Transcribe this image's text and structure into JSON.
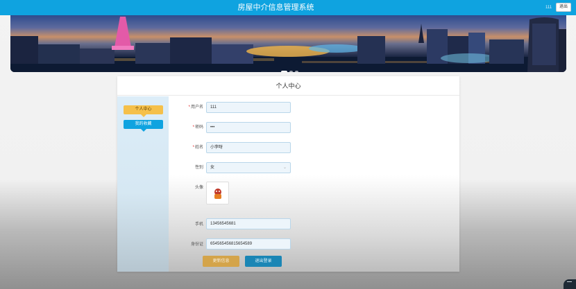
{
  "app": {
    "title": "房屋中介信息管理系统",
    "user": "111",
    "logout_label": "退出"
  },
  "banner": {
    "slides": 3,
    "active_slide": 1
  },
  "page": {
    "title": "个人中心"
  },
  "sidebar": {
    "items": [
      {
        "label": "个人中心",
        "active": true
      },
      {
        "label": "我的收藏",
        "active": false
      }
    ]
  },
  "form": {
    "username": {
      "label": "用户名",
      "required": true,
      "value": "111"
    },
    "password": {
      "label": "密码",
      "required": true,
      "value": "•••"
    },
    "name": {
      "label": "姓名",
      "required": true,
      "value": "小李呀"
    },
    "gender": {
      "label": "性别",
      "required": false,
      "value": "女"
    },
    "avatar": {
      "label": "头像"
    },
    "phone": {
      "label": "手机",
      "required": false,
      "value": "13456545681"
    },
    "id_card": {
      "label": "身份证",
      "required": false,
      "value": "654565456815654589"
    }
  },
  "buttons": {
    "update_label": "更新信息",
    "exit_label": "退出登录"
  },
  "colors": {
    "primary": "#0fa3e0",
    "accent": "#f5c04a",
    "required": "#e02020"
  }
}
